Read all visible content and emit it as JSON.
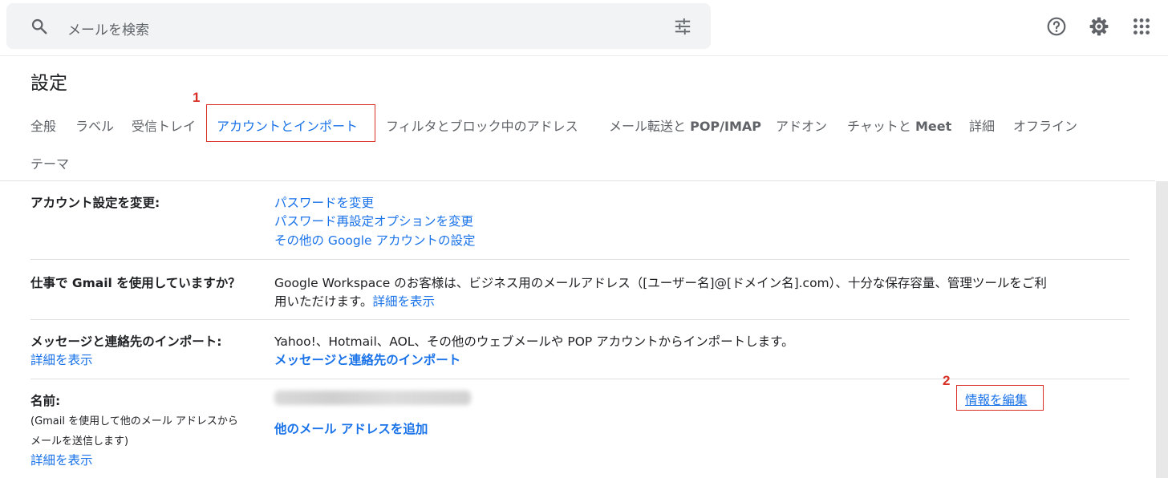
{
  "search": {
    "placeholder": "メールを検索"
  },
  "icons": {
    "search": "search-icon",
    "tune": "tune-icon",
    "help": "help-icon",
    "settings": "gear-icon",
    "apps": "apps-icon"
  },
  "page": {
    "title": "設定"
  },
  "tabs": [
    {
      "label": "全般"
    },
    {
      "label": "ラベル"
    },
    {
      "label": "受信トレイ"
    },
    {
      "label": "アカウントとインポート",
      "active": true
    },
    {
      "label": "フィルタとブロック中のアドレス"
    },
    {
      "label_pre": "メール転送と ",
      "label_bold": "POP/IMAP"
    },
    {
      "label": "アドオン"
    },
    {
      "label_pre": "チャットと ",
      "label_bold": "Meet"
    },
    {
      "label": "詳細"
    },
    {
      "label": "オフライン"
    },
    {
      "label": "テーマ"
    }
  ],
  "annotations": {
    "one": "1",
    "two": "2"
  },
  "sections": {
    "account": {
      "label": "アカウント設定を変更:",
      "links": [
        "パスワードを変更",
        "パスワード再設定オプションを変更",
        "その他の Google アカウントの設定"
      ]
    },
    "workspace": {
      "label": "仕事で Gmail を使用していますか？",
      "text_line1": "Google Workspace のお客様は、ビジネス用のメールアドレス（[ユーザー名]@[ドメイン名].com）、十分な保存容量、管理ツールをご利",
      "text_line2": "用いただけます。",
      "link": "詳細を表示"
    },
    "import": {
      "label": "メッセージと連絡先のインポート:",
      "sublink": "詳細を表示",
      "text": "Yahoo!、Hotmail、AOL、その他のウェブメールや POP アカウントからインポートします。",
      "link": "メッセージと連絡先のインポート"
    },
    "name": {
      "label": "名前:",
      "desc_line1": "(Gmail を使用して他のメール アドレスから",
      "desc_line2": "メールを送信します)",
      "sublink": "詳細を表示",
      "add_link": "他のメール アドレスを追加",
      "edit_link": "情報を編集"
    }
  },
  "colors": {
    "accent": "#1a73e8",
    "annotation": "#d93025"
  }
}
